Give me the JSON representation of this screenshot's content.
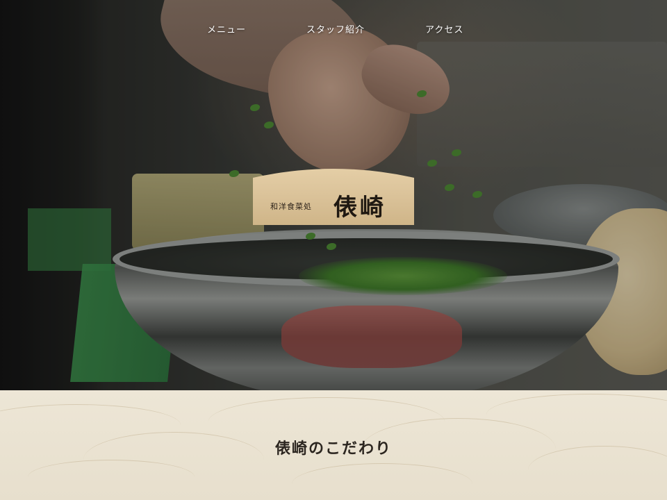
{
  "nav": {
    "items": [
      {
        "label": "メニュー"
      },
      {
        "label": "スタッフ紹介"
      },
      {
        "label": "アクセス"
      }
    ]
  },
  "logo": {
    "subtitle": "和洋食菜処",
    "name": "俵崎"
  },
  "section": {
    "title": "俵崎のこだわり"
  },
  "colors": {
    "nav_text": "#ffffff",
    "plaque": "#dbc39a",
    "paper_bg": "#ede6d6",
    "title_text": "#2c2620"
  }
}
